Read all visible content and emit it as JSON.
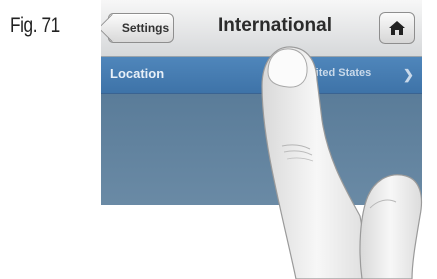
{
  "figure": {
    "label": "Fig. 71"
  },
  "navbar": {
    "back_label": "Settings",
    "title": "International",
    "home_icon": "home-icon"
  },
  "list": {
    "rows": [
      {
        "label": "Location",
        "value": "United States",
        "icon": "chevron-right-icon"
      }
    ]
  },
  "colors": {
    "selected_row": "#4a80b5",
    "navbar": "#e4e6e8",
    "background": "#5b7e9b"
  }
}
